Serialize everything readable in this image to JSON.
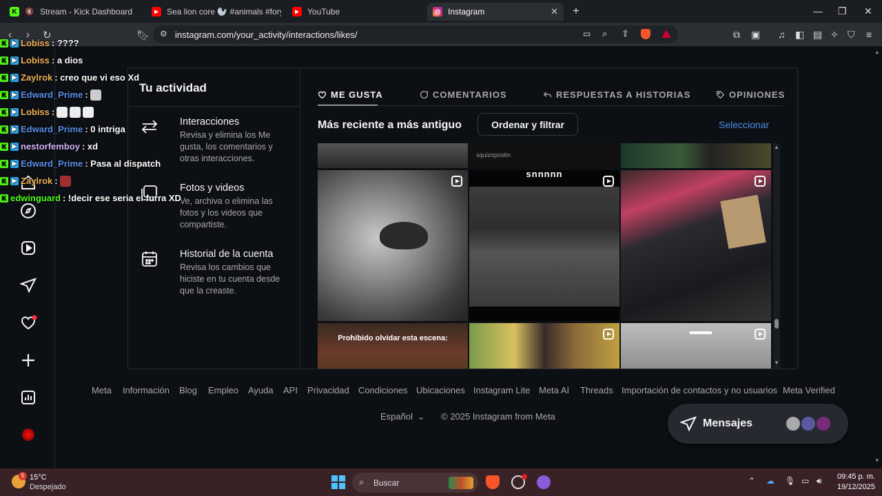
{
  "browser": {
    "tabs": [
      {
        "title": "Stream - Kick Dashboard",
        "active": false
      },
      {
        "title": "Sea lion core 🦭 #animals #foryou #",
        "active": false
      },
      {
        "title": "YouTube",
        "active": false
      },
      {
        "title": "Instagram",
        "active": true
      }
    ],
    "url": "instagram.com/your_activity/interactions/likes/"
  },
  "chat_overlay": [
    {
      "user": "Lobiss",
      "text": ": ????",
      "color": "#f0b35a"
    },
    {
      "user": "Lobiss",
      "text": ": a dios",
      "color": "#f0b35a"
    },
    {
      "user": "Zaylrok",
      "text": ": creo que vi eso Xd",
      "color": "#f0b35a"
    },
    {
      "user": "Edward_Prime",
      "text": ":",
      "color": "#5b8fe8"
    },
    {
      "user": "Lobiss",
      "text": ":",
      "color": "#f0b35a"
    },
    {
      "user": "Edward_Prime",
      "text": ": 0 intriga",
      "color": "#5b8fe8"
    },
    {
      "user": "nestorfemboy",
      "text": ": xd",
      "color": "#d6b4ff"
    },
    {
      "user": "Edward_Prime",
      "text": ": Pasa al dispatch",
      "color": "#5b8fe8"
    },
    {
      "user": "Zaylrok",
      "text": ":",
      "color": "#f0b35a"
    },
    {
      "user": "edwinguard",
      "text": ": !decir ese seria el furra XD",
      "color": "#53fc18"
    }
  ],
  "activity": {
    "title": "Tu actividad",
    "menu": [
      {
        "title": "Interacciones",
        "desc": "Revisa y elimina los Me gusta, los comentarios y otras interacciones.",
        "icon": "arrows-swap-icon"
      },
      {
        "title": "Fotos y videos",
        "desc": "Ve, archiva o elimina las fotos y los videos que compartiste.",
        "icon": "photos-icon"
      },
      {
        "title": "Historial de la cuenta",
        "desc": "Revisa los cambios que hiciste en tu cuenta desde que la creaste.",
        "icon": "calendar-icon"
      }
    ],
    "tabs": [
      {
        "label": "ME GUSTA",
        "icon": "heart-icon"
      },
      {
        "label": "COMENTARIOS",
        "icon": "comment-icon"
      },
      {
        "label": "RESPUESTAS A HISTORIAS",
        "icon": "reply-icon"
      },
      {
        "label": "OPINIONES",
        "icon": "tag-icon"
      }
    ],
    "sort_label": "Más reciente a más antiguo",
    "sort_button": "Ordenar y filtrar",
    "select_link": "Seleccionar",
    "grid_texts": {
      "top_middle": "squizopostin",
      "reel2": "snnnnn",
      "reel4": "Prohibido olvidar esta escena:"
    }
  },
  "footer": {
    "links": [
      "Meta",
      "Información",
      "Blog",
      "Empleo",
      "Ayuda",
      "API",
      "Privacidad",
      "Condiciones",
      "Ubicaciones",
      "Instagram Lite",
      "Meta AI",
      "Threads",
      "Importación de contactos y no usuarios",
      "Meta Verified"
    ],
    "language": "Español",
    "copyright": "© 2025 Instagram from Meta"
  },
  "messages": {
    "label": "Mensajes"
  },
  "taskbar": {
    "temp": "15°C",
    "weather": "Despejado",
    "search": "Buscar",
    "time": "09:45 p. m.",
    "date": "19/12/2025",
    "weather_badge": "5"
  }
}
